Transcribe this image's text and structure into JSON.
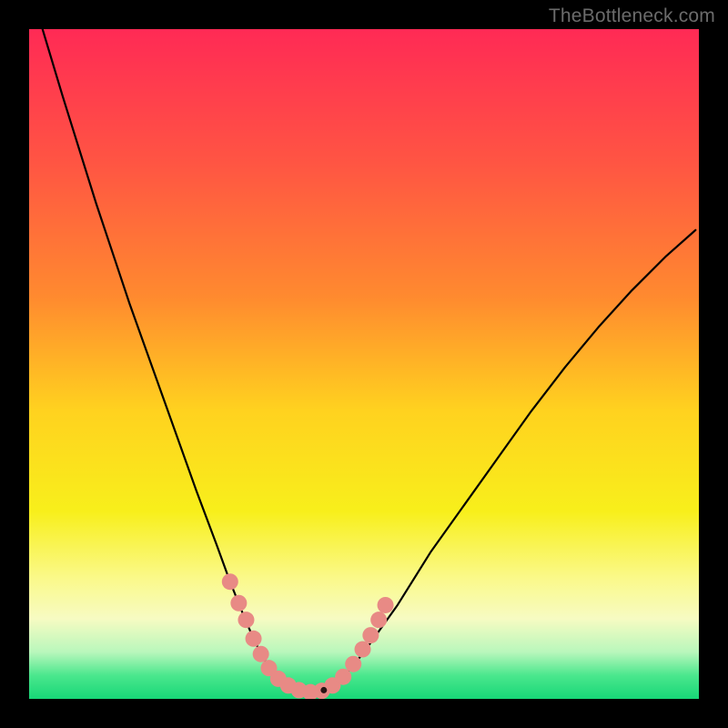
{
  "watermark": "TheBottleneck.com",
  "colors": {
    "frame_bg": "#000000",
    "curve_stroke": "#000000",
    "marker_fill": "#e88a85",
    "marker_dark": "#281515"
  },
  "gradient_stops": [
    {
      "offset": 0.0,
      "color": "#ff2a55"
    },
    {
      "offset": 0.2,
      "color": "#ff5543"
    },
    {
      "offset": 0.4,
      "color": "#ff8a2f"
    },
    {
      "offset": 0.57,
      "color": "#ffd21f"
    },
    {
      "offset": 0.72,
      "color": "#f8ef1b"
    },
    {
      "offset": 0.82,
      "color": "#faf98a"
    },
    {
      "offset": 0.88,
      "color": "#f7fbc2"
    },
    {
      "offset": 0.93,
      "color": "#b9f7bc"
    },
    {
      "offset": 0.965,
      "color": "#4be78d"
    },
    {
      "offset": 1.0,
      "color": "#17d777"
    }
  ],
  "chart_data": {
    "type": "line",
    "title": "",
    "xlabel": "",
    "ylabel": "",
    "xlim": [
      0,
      100
    ],
    "ylim": [
      0,
      100
    ],
    "grid": false,
    "legend": false,
    "series": [
      {
        "name": "left_branch",
        "x": [
          2,
          5,
          10,
          15,
          20,
          25,
          28,
          30,
          32,
          33.5,
          35,
          36.5,
          38,
          40,
          42
        ],
        "y": [
          100,
          90,
          74,
          59,
          45,
          31,
          23,
          17.5,
          12.5,
          9,
          6,
          4,
          2.5,
          1.4,
          1
        ]
      },
      {
        "name": "right_branch",
        "x": [
          42,
          44,
          46,
          48,
          50,
          55,
          60,
          65,
          70,
          75,
          80,
          85,
          90,
          95,
          99.5
        ],
        "y": [
          1,
          1.3,
          2.4,
          4.5,
          7,
          14,
          22,
          29,
          36,
          43,
          49.5,
          55.5,
          61,
          66,
          70
        ]
      }
    ],
    "markers": [
      {
        "x": 30.0,
        "y": 17.5,
        "r": 9
      },
      {
        "x": 31.3,
        "y": 14.3,
        "r": 9
      },
      {
        "x": 32.4,
        "y": 11.8,
        "r": 9
      },
      {
        "x": 33.5,
        "y": 9.0,
        "r": 9
      },
      {
        "x": 34.6,
        "y": 6.7,
        "r": 9
      },
      {
        "x": 35.8,
        "y": 4.6,
        "r": 9
      },
      {
        "x": 37.2,
        "y": 3.0,
        "r": 9
      },
      {
        "x": 38.7,
        "y": 2.0,
        "r": 9
      },
      {
        "x": 40.3,
        "y": 1.3,
        "r": 9
      },
      {
        "x": 42.0,
        "y": 1.0,
        "r": 9
      },
      {
        "x": 43.7,
        "y": 1.2,
        "r": 9
      },
      {
        "x": 45.3,
        "y": 2.0,
        "r": 9
      },
      {
        "x": 46.9,
        "y": 3.3,
        "r": 9
      },
      {
        "x": 48.4,
        "y": 5.2,
        "r": 9
      },
      {
        "x": 49.8,
        "y": 7.4,
        "r": 9
      },
      {
        "x": 51.0,
        "y": 9.5,
        "r": 9
      },
      {
        "x": 52.2,
        "y": 11.8,
        "r": 9
      },
      {
        "x": 53.2,
        "y": 14.0,
        "r": 9
      },
      {
        "x": 44.0,
        "y": 1.3,
        "r": 3.5,
        "dark": true
      }
    ]
  }
}
